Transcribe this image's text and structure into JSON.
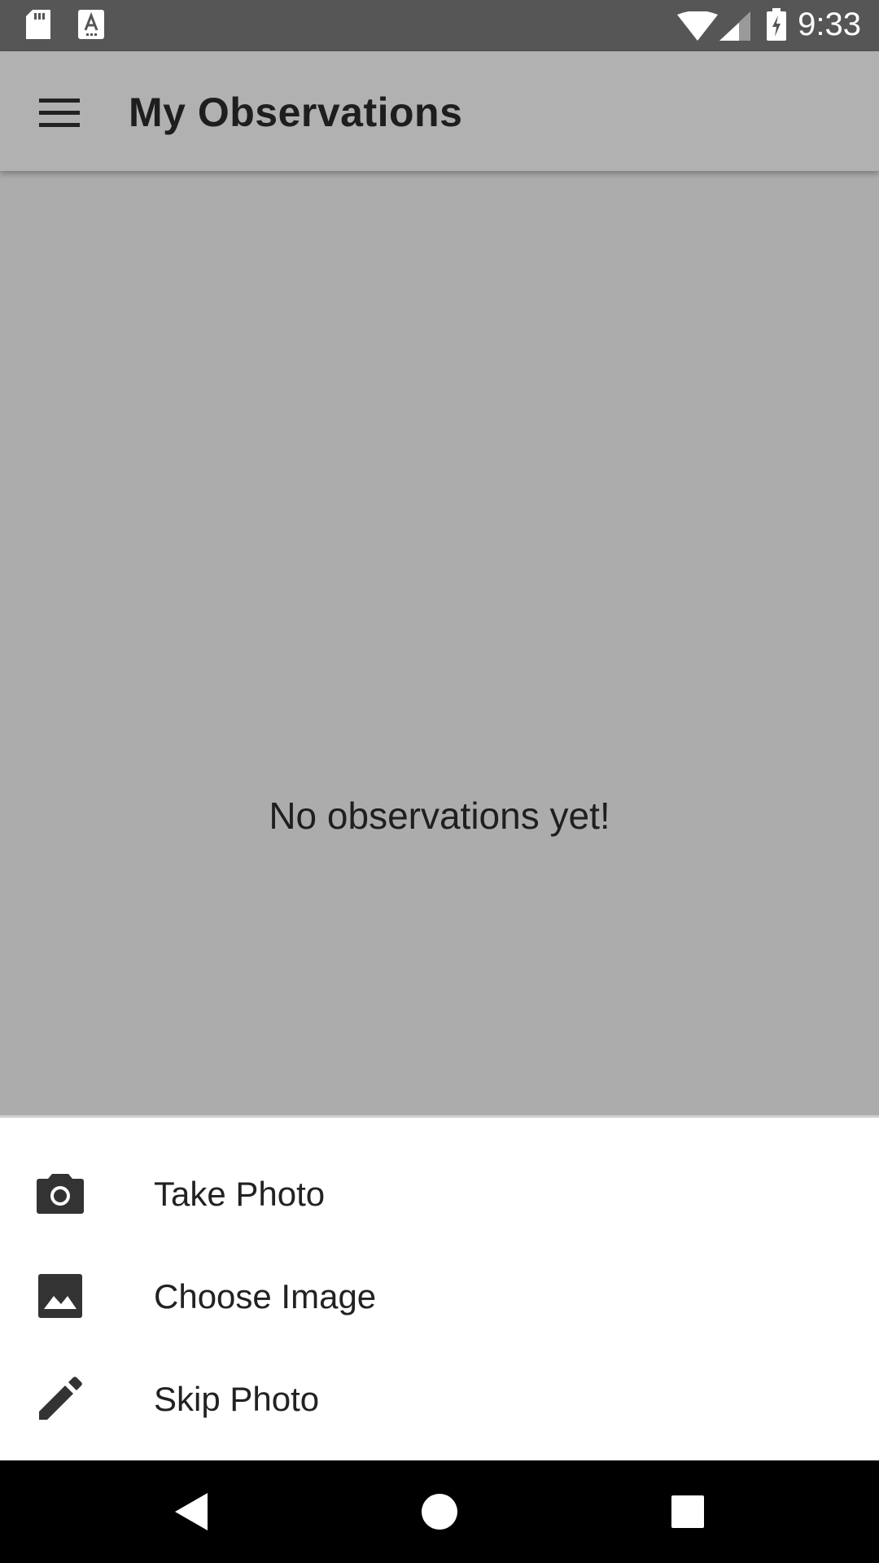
{
  "status_bar": {
    "time": "9:33",
    "icons_left": [
      "sd-card-icon",
      "font-a-icon"
    ],
    "icons_right": [
      "wifi-icon",
      "signal-icon",
      "battery-charging-icon"
    ]
  },
  "app_bar": {
    "title": "My Observations",
    "menu_icon": "hamburger-menu-icon"
  },
  "content": {
    "empty_message": "No observations yet!"
  },
  "bottom_sheet": {
    "items": [
      {
        "label": "Take Photo",
        "icon": "camera-icon"
      },
      {
        "label": "Choose Image",
        "icon": "image-icon"
      },
      {
        "label": "Skip Photo",
        "icon": "pencil-icon"
      }
    ]
  },
  "nav_bar": {
    "buttons": [
      "back-icon",
      "home-icon",
      "recents-icon"
    ]
  },
  "colors": {
    "status_bar": "#565656",
    "app_bar": "#b1b1b1",
    "scrim_content": "#acacac",
    "sheet": "#ffffff",
    "nav_bar": "#000000"
  }
}
